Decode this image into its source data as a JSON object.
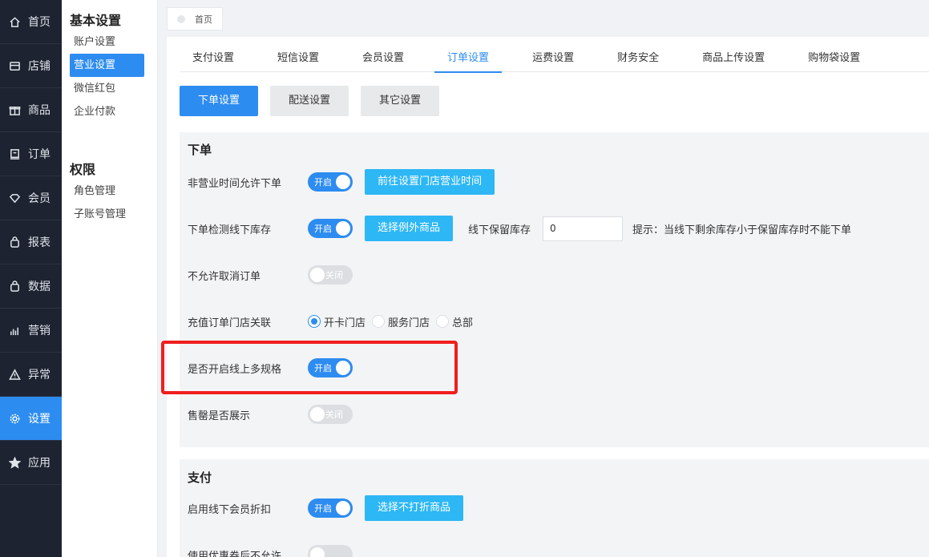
{
  "nav": [
    {
      "label": "首页",
      "icon": "home-icon"
    },
    {
      "label": "店铺",
      "icon": "store-icon"
    },
    {
      "label": "商品",
      "icon": "gift-icon"
    },
    {
      "label": "订单",
      "icon": "order-icon"
    },
    {
      "label": "会员",
      "icon": "member-icon"
    },
    {
      "label": "报表",
      "icon": "report-icon"
    },
    {
      "label": "数据",
      "icon": "data-icon"
    },
    {
      "label": "营销",
      "icon": "marketing-icon"
    },
    {
      "label": "异常",
      "icon": "warning-icon"
    },
    {
      "label": "设置",
      "icon": "settings-icon",
      "active": true
    },
    {
      "label": "应用",
      "icon": "star-icon"
    }
  ],
  "subnav": {
    "basic_title": "基本设置",
    "basic_items": [
      "账户设置",
      "营业设置",
      "微信红包",
      "企业付款"
    ],
    "perm_title": "权限",
    "perm_items": [
      "角色管理",
      "子账号管理"
    ]
  },
  "breadcrumb": {
    "label": "首页"
  },
  "tabs": [
    "支付设置",
    "短信设置",
    "会员设置",
    "订单设置",
    "运费设置",
    "财务安全",
    "商品上传设置",
    "购物袋设置"
  ],
  "active_tab": "订单设置",
  "seg_buttons": [
    "下单设置",
    "配送设置",
    "其它设置"
  ],
  "order_section": {
    "title": "下单",
    "allow_off_hours": {
      "label": "非营业时间允许下单",
      "switch": "开启",
      "button": "前往设置门店营业时间"
    },
    "check_stock": {
      "label": "下单检测线下库存",
      "switch": "开启",
      "button": "选择例外商品",
      "reserve_label": "线下保留库存",
      "reserve_value": "0",
      "hint": "提示：当线下剩余库存小于保留库存时不能下单"
    },
    "disallow_cancel": {
      "label": "不允许取消订单",
      "switch": "关闭"
    },
    "recharge_store": {
      "label": "充值订单门店关联",
      "options": [
        "开卡门店",
        "服务门店",
        "总部"
      ],
      "selected": "开卡门店"
    },
    "multi_spec": {
      "label": "是否开启线上多规格",
      "switch": "开启"
    },
    "sold_out": {
      "label": "售罄是否展示",
      "switch": "关闭"
    }
  },
  "pay_section": {
    "title": "支付",
    "member_discount": {
      "label": "启用线下会员折扣",
      "switch": "开启",
      "button": "选择不打折商品"
    },
    "coupon_row": {
      "label": "使用优惠券后不允许"
    }
  },
  "colors": {
    "primary": "#2d8cf0",
    "info": "#2db7f5",
    "nav_bg": "#1d2330",
    "highlight": "#f01e1e"
  }
}
